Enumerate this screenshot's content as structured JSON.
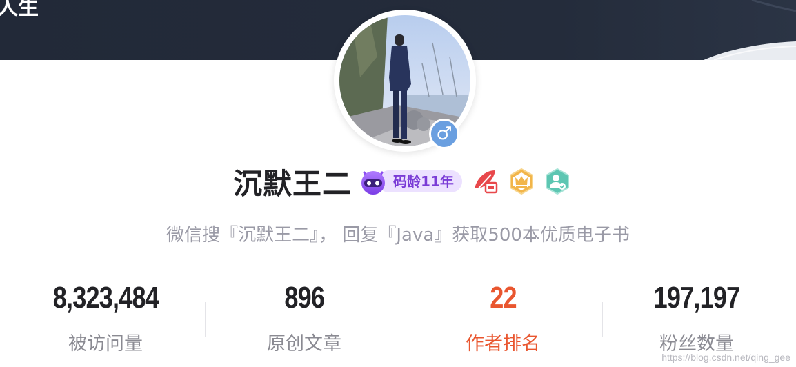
{
  "banner": {
    "partial_text": "人生",
    "background_color": "#222938"
  },
  "profile": {
    "avatar_icon": "user-photo",
    "gender_symbol": "♂",
    "gender_icon": "male-icon",
    "name": "沉默王二",
    "code_age_label": "码龄11年",
    "badges": [
      "blog-expert-icon",
      "crown-icon",
      "verified-user-icon"
    ]
  },
  "bio": "微信搜『沉默王二』， 回复『Java』获取500本优质电子书",
  "stats": [
    {
      "value": "8,323,484",
      "label": "被访问量"
    },
    {
      "value": "896",
      "label": "原创文章"
    },
    {
      "value": "22",
      "label": "作者排名"
    },
    {
      "value": "197,197",
      "label": "粉丝数量"
    }
  ],
  "watermark": "https://blog.csdn.net/qing_gee",
  "colors": {
    "accent_rank": "#e9562f",
    "code_age_text": "#7a3cd6",
    "code_age_bg": "#ece1ff",
    "gender_badge": "#6a9fe0",
    "stat_label": "#8a8a92",
    "bio_text": "#9a9aa6"
  }
}
